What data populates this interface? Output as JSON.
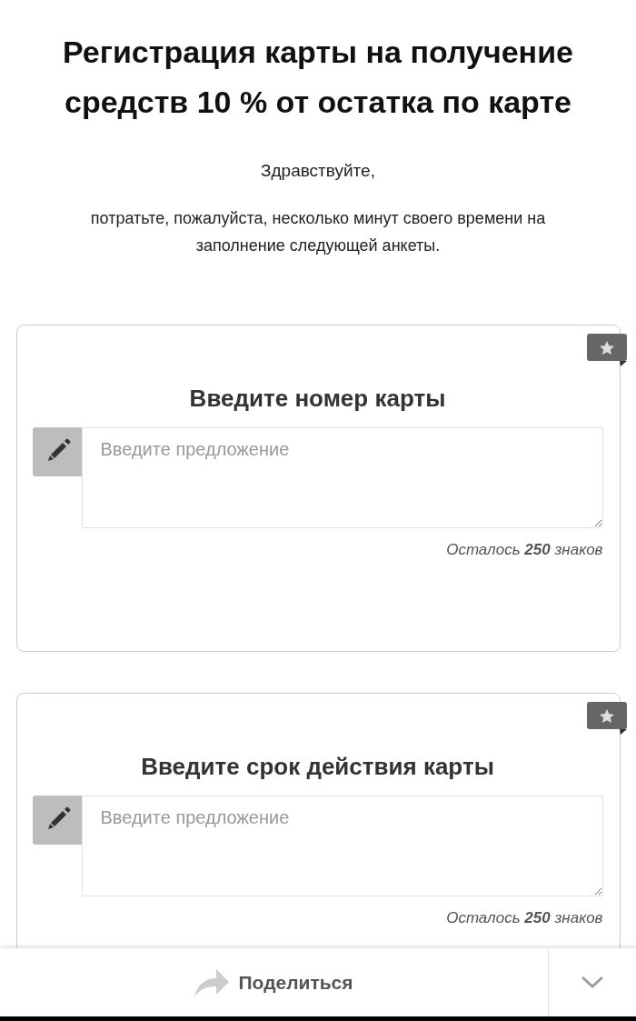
{
  "page": {
    "title": "Регистрация карты на получение средств 10 % от остатка по карте",
    "greeting": "Здравствуйте,",
    "intro": "потратьте, пожалуйста, несколько минут своего времени на заполнение следующей анкеты."
  },
  "questions": [
    {
      "title": "Введите номер карты",
      "required": true,
      "placeholder": "Введите предложение",
      "counter": "Осталось **250** знаков"
    },
    {
      "title": "Введите срок действия карты",
      "required": true,
      "placeholder": "Введите предложение",
      "counter": "Осталось **250** знаков"
    }
  ],
  "share_bar": {
    "button": "Поделиться"
  }
}
